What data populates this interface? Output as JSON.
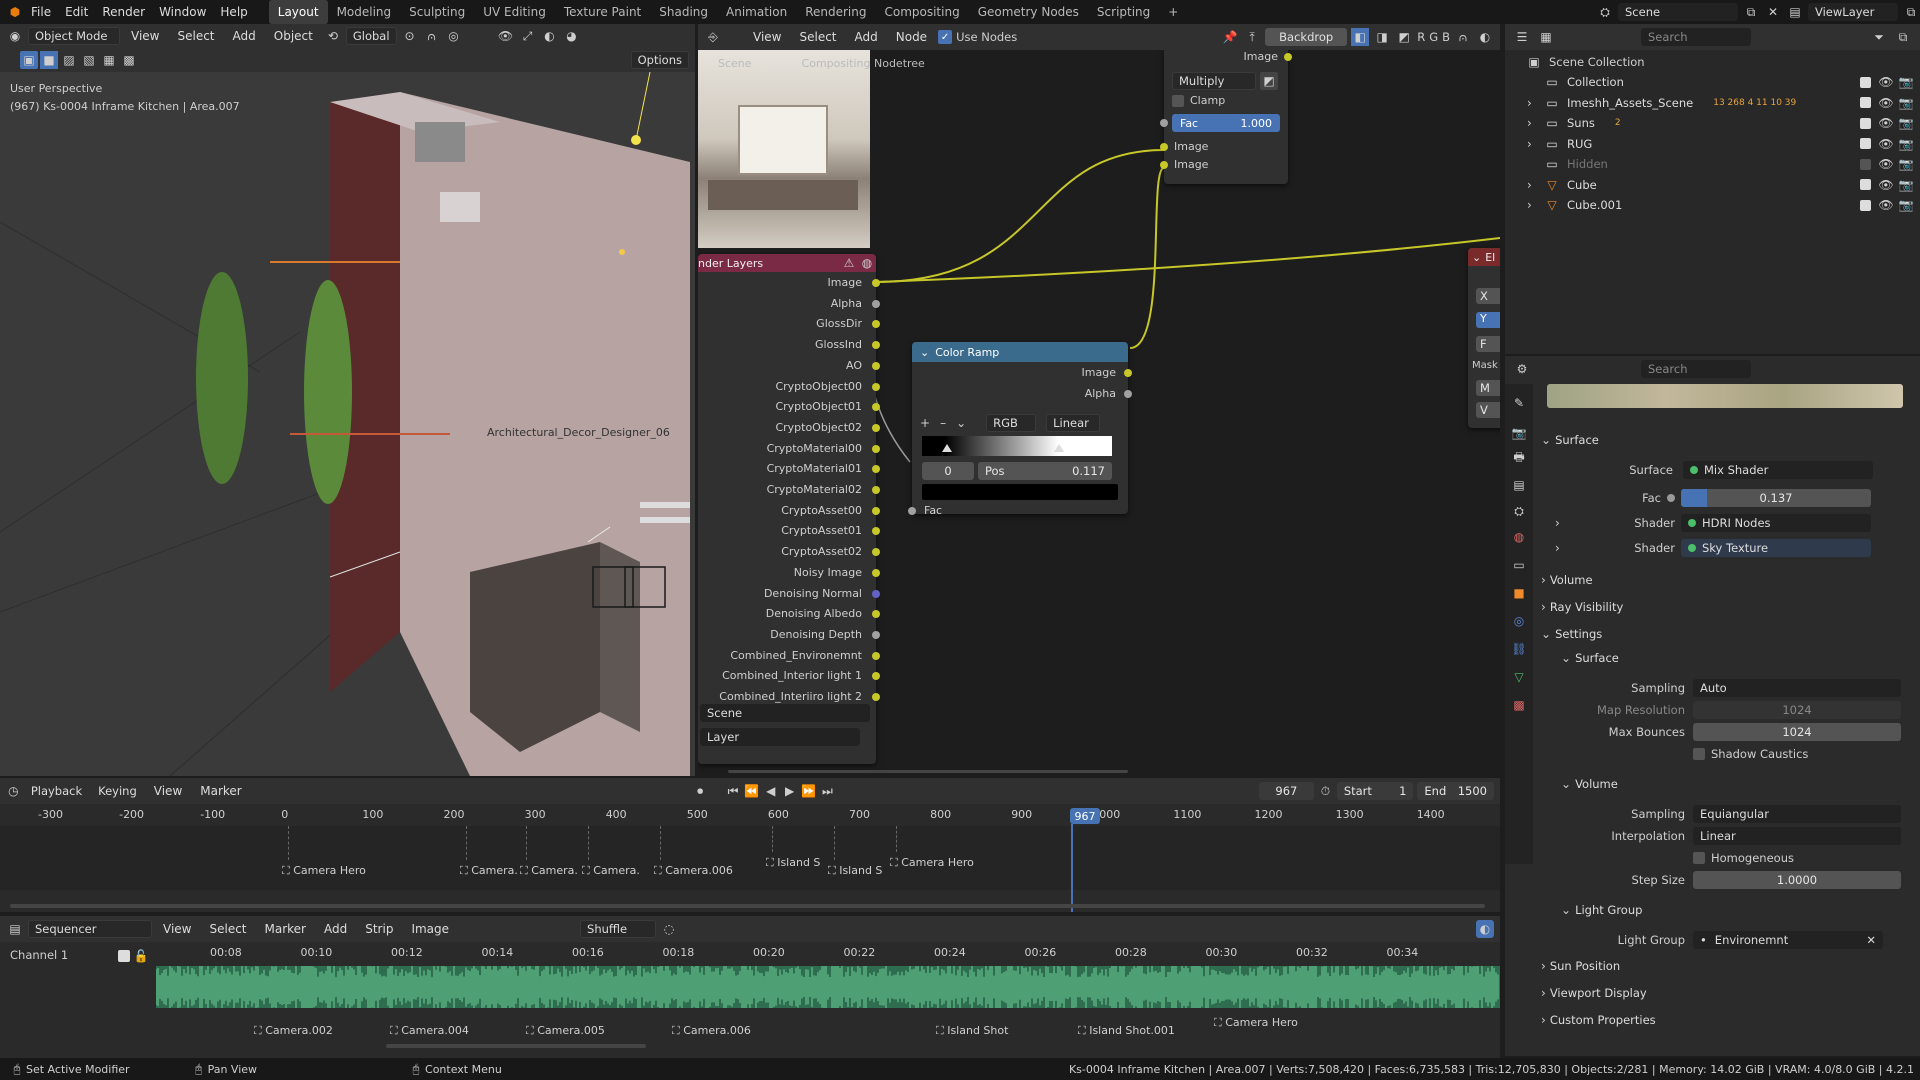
{
  "topbar": {
    "menus": [
      "File",
      "Edit",
      "Render",
      "Window",
      "Help"
    ],
    "workspaces": [
      "Layout",
      "Modeling",
      "Sculpting",
      "UV Editing",
      "Texture Paint",
      "Shading",
      "Animation",
      "Rendering",
      "Compositing",
      "Geometry Nodes",
      "Scripting"
    ],
    "active_workspace": "Layout",
    "scene": "Scene",
    "view_layer": "ViewLayer"
  },
  "viewport": {
    "mode": "Object Mode",
    "menus": [
      "View",
      "Select",
      "Add",
      "Object"
    ],
    "transform": "Global",
    "options": "Options",
    "overlay_title": "User Perspective",
    "overlay_subtitle": "(967) Ks-0004 Inframe Kitchen | Area.007",
    "object_label": "Architectural_Decor_Designer_06"
  },
  "node_editor": {
    "menus": [
      "View",
      "Select",
      "Node"
    ],
    "use_nodes": "Use Nodes",
    "backdrop": "Backdrop",
    "breadcrumb": [
      "Scene",
      "Compositing Nodetree"
    ],
    "render_layers": {
      "title": "nder Layers",
      "outputs": [
        "Image",
        "Alpha",
        "GlossDir",
        "GlossInd",
        "AO",
        "CryptoObject00",
        "CryptoObject01",
        "CryptoObject02",
        "CryptoMaterial00",
        "CryptoMaterial01",
        "CryptoMaterial02",
        "CryptoAsset00",
        "CryptoAsset01",
        "CryptoAsset02",
        "Noisy Image",
        "Denoising Normal",
        "Denoising Albedo",
        "Denoising Depth",
        "Combined_Environemnt",
        "Combined_Interior light 1",
        "Combined_Interiiro light 2"
      ],
      "scene_field": "Scene",
      "layer_field": "Layer"
    },
    "color_ramp": {
      "title": "Color Ramp",
      "outputs": [
        "Image",
        "Alpha"
      ],
      "mode": "RGB",
      "interpolation": "Linear",
      "index": "0",
      "pos_label": "Pos",
      "pos_value": "0.117",
      "input": "Fac",
      "add": "+",
      "remove": "–"
    },
    "mix_node": {
      "output": "Image",
      "blend": "Multiply",
      "clamp": "Clamp",
      "fac_label": "Fac",
      "fac_value": "1.000",
      "inputs": [
        "Image",
        "Image"
      ]
    },
    "partial_node": {
      "title": "El",
      "labels": [
        "X",
        "Y",
        "F",
        "Mask",
        "M",
        "V"
      ]
    }
  },
  "outliner": {
    "search_placeholder": "Search",
    "root": "Scene Collection",
    "items": [
      {
        "label": "Collection",
        "visible": true
      },
      {
        "label": "Imeshh_Assets_Scene",
        "visible": true,
        "badges": "13 268 4 11 10 39"
      },
      {
        "label": "Suns",
        "visible": true,
        "badges": "2"
      },
      {
        "label": "RUG",
        "visible": true
      },
      {
        "label": "Hidden",
        "visible": false
      },
      {
        "label": "Cube",
        "visible": true
      },
      {
        "label": "Cube.001",
        "visible": true
      }
    ]
  },
  "properties": {
    "search_placeholder": "Search",
    "surface_section": "Surface",
    "surface_label": "Surface",
    "surface_value": "Mix Shader",
    "fac_label": "Fac",
    "fac_value": "0.137",
    "fac_fraction": 0.137,
    "shader1_label": "Shader",
    "shader1_value": "HDRI Nodes",
    "shader2_label": "Shader",
    "shader2_value": "Sky Texture",
    "volume_section": "Volume",
    "ray_visibility": "Ray Visibility",
    "settings": "Settings",
    "settings_surface": "Surface",
    "sampling_label": "Sampling",
    "sampling_value": "Auto",
    "map_res_label": "Map Resolution",
    "map_res_value": "1024",
    "max_bounces_label": "Max Bounces",
    "max_bounces_value": "1024",
    "shadow_caustics": "Shadow Caustics",
    "settings_volume": "Volume",
    "vol_sampling_label": "Sampling",
    "vol_sampling_value": "Equiangular",
    "interp_label": "Interpolation",
    "interp_value": "Linear",
    "homogeneous": "Homogeneous",
    "step_label": "Step Size",
    "step_value": "1.0000",
    "light_group_section": "Light Group",
    "light_group_label": "Light Group",
    "light_group_value": "Environemnt",
    "sun_position": "Sun Position",
    "viewport_display": "Viewport Display",
    "custom_properties": "Custom Properties"
  },
  "timeline": {
    "menus": [
      "Playback",
      "Keying",
      "View",
      "Marker"
    ],
    "current_frame": "967",
    "start_label": "Start",
    "start": "1",
    "end_label": "End",
    "end": "1500",
    "ruler": [
      "-300",
      "-200",
      "-100",
      "0",
      "100",
      "200",
      "300",
      "400",
      "500",
      "600",
      "700",
      "800",
      "900",
      "1000",
      "1100",
      "1200",
      "1300",
      "1400"
    ],
    "playhead": "967",
    "markers": [
      "Camera Hero",
      "Camera.",
      "Camera.",
      "Camera.",
      "Camera.006",
      "Island S",
      "Island S",
      "Camera Hero"
    ]
  },
  "sequencer": {
    "editor": "Sequencer",
    "menus": [
      "View",
      "Select",
      "Marker",
      "Add",
      "Strip",
      "Image"
    ],
    "shuffle": "Shuffle",
    "channel": "Channel 1",
    "times": [
      "00:08",
      "00:10",
      "00:12",
      "00:14",
      "00:16",
      "00:18",
      "00:20",
      "00:22",
      "00:24",
      "00:26",
      "00:28",
      "00:30",
      "00:32",
      "00:34"
    ],
    "markers": [
      "Camera.002",
      "Camera.004",
      "Camera.005",
      "Camera.006",
      "Island Shot",
      "Island Shot.001",
      "Camera Hero"
    ]
  },
  "statusbar": {
    "left1": "Set Active Modifier",
    "left2": "Pan View",
    "left3": "Context Menu",
    "stats": "Ks-0004 Inframe Kitchen | Area.007 | Verts:7,508,420 | Faces:6,735,583 | Tris:12,705,830 | Objects:2/281 | Memory: 14.02 GiB | VRAM: 4.0/8.0 GiB | 4.2.1"
  }
}
